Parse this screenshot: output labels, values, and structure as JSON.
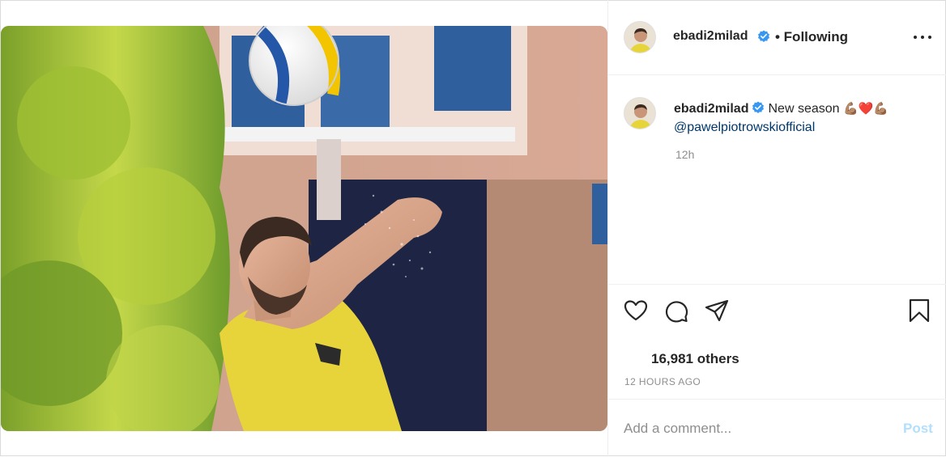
{
  "post": {
    "username": "ebadi2milad",
    "follow_status": "• Following",
    "caption_text": "New season",
    "caption_emoji": "💪🏽❤️💪🏽",
    "mention": "@pawelpiotrowskiofficial",
    "caption_time": "12h",
    "likes_text": "16,981 others",
    "post_time": "12 HOURS AGO"
  },
  "comment": {
    "placeholder": "Add a comment...",
    "post_label": "Post"
  },
  "colors": {
    "verified": "#3897f0",
    "link": "#00376b",
    "post_button": "#b2dffc",
    "muted": "#8e8e8e",
    "jersey": "#e6d43a"
  },
  "icons": [
    "heart-icon",
    "comment-icon",
    "share-icon",
    "bookmark-icon",
    "more-options-icon",
    "verified-badge-icon"
  ]
}
